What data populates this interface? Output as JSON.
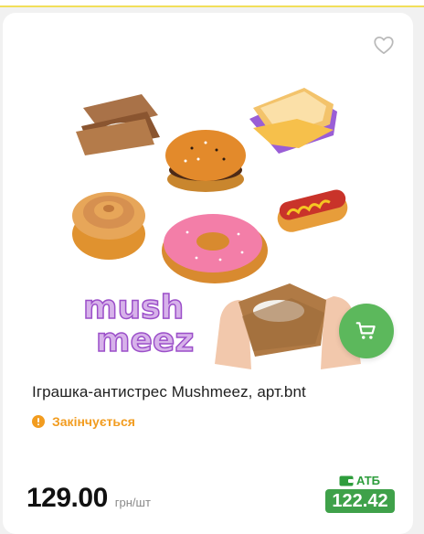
{
  "product": {
    "title": "Іграшка-антистрес Mushmeez, арт.bnt",
    "status": "Закінчується",
    "price": "129.00",
    "unit": "грн/шт",
    "promo_label": "АТБ",
    "promo_price": "122.42",
    "image_logo_text": "mushmeez",
    "status_icon": "exclamation-circle-icon",
    "favorite_icon": "heart-outline-icon",
    "cart_icon": "shopping-cart-icon",
    "promo_icon": "wallet-icon"
  },
  "colors": {
    "cart_button": "#5cb85c",
    "status": "#f29c1f",
    "promo": "#3fa14a",
    "card_bg": "#ffffff",
    "page_bg": "#f1f1f1"
  }
}
